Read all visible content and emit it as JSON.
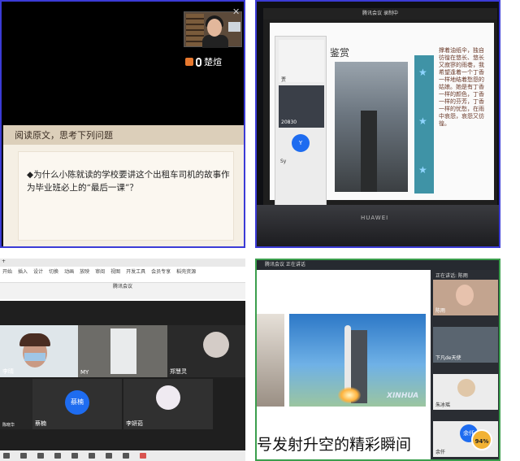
{
  "panel1": {
    "participant_name": "楚煊",
    "section_heading": "阅读原文，思考下列问题",
    "question": "◆为什么小陈就读的学校要讲这个出租车司机的故事作为毕业班必上的“最后一课”？"
  },
  "panel2": {
    "topbar_text": "腾讯会议  录制中",
    "slide_title": "鉴赏",
    "sidebar_names": [
      "贾",
      "20830",
      "Y",
      "Sy"
    ],
    "poem_text": "撑着油纸伞，独自彷徨在悠长、悠长又寂寥的雨巷，我希望逢着一个丁香一样地结着愁怨的姑娘。她是有丁香一样的颜色，丁香一样的芬芳，丁香一样的忧愁，在雨中哀怨，哀怨又彷徨。",
    "monitor_brand": "HUAWEI"
  },
  "panel3": {
    "meeting_title": "腾讯会议",
    "menu_items": [
      "开始",
      "插入",
      "设计",
      "切换",
      "动画",
      "放映",
      "审阅",
      "视图",
      "开发工具",
      "会员专享",
      "稻壳资源"
    ],
    "tiles": [
      {
        "name": "李晴"
      },
      {
        "name": "MY"
      },
      {
        "name": "郑慧灵"
      },
      {
        "name": "陈晓华"
      },
      {
        "name": "蔡楠"
      },
      {
        "name": "李妍茹"
      }
    ],
    "circle_label": "蔡楠"
  },
  "panel4": {
    "top_text": "腾讯会议  正在讲话",
    "speaking_label": "正在讲话: 陈雨",
    "watermark": "XINHUA",
    "caption": "号发射升空的精彩瞬间",
    "roster": [
      "陈雨",
      "下凡de天使",
      "朱冰瑶",
      "余仟"
    ],
    "badge_value": "94%",
    "circle_label": "余仟"
  }
}
